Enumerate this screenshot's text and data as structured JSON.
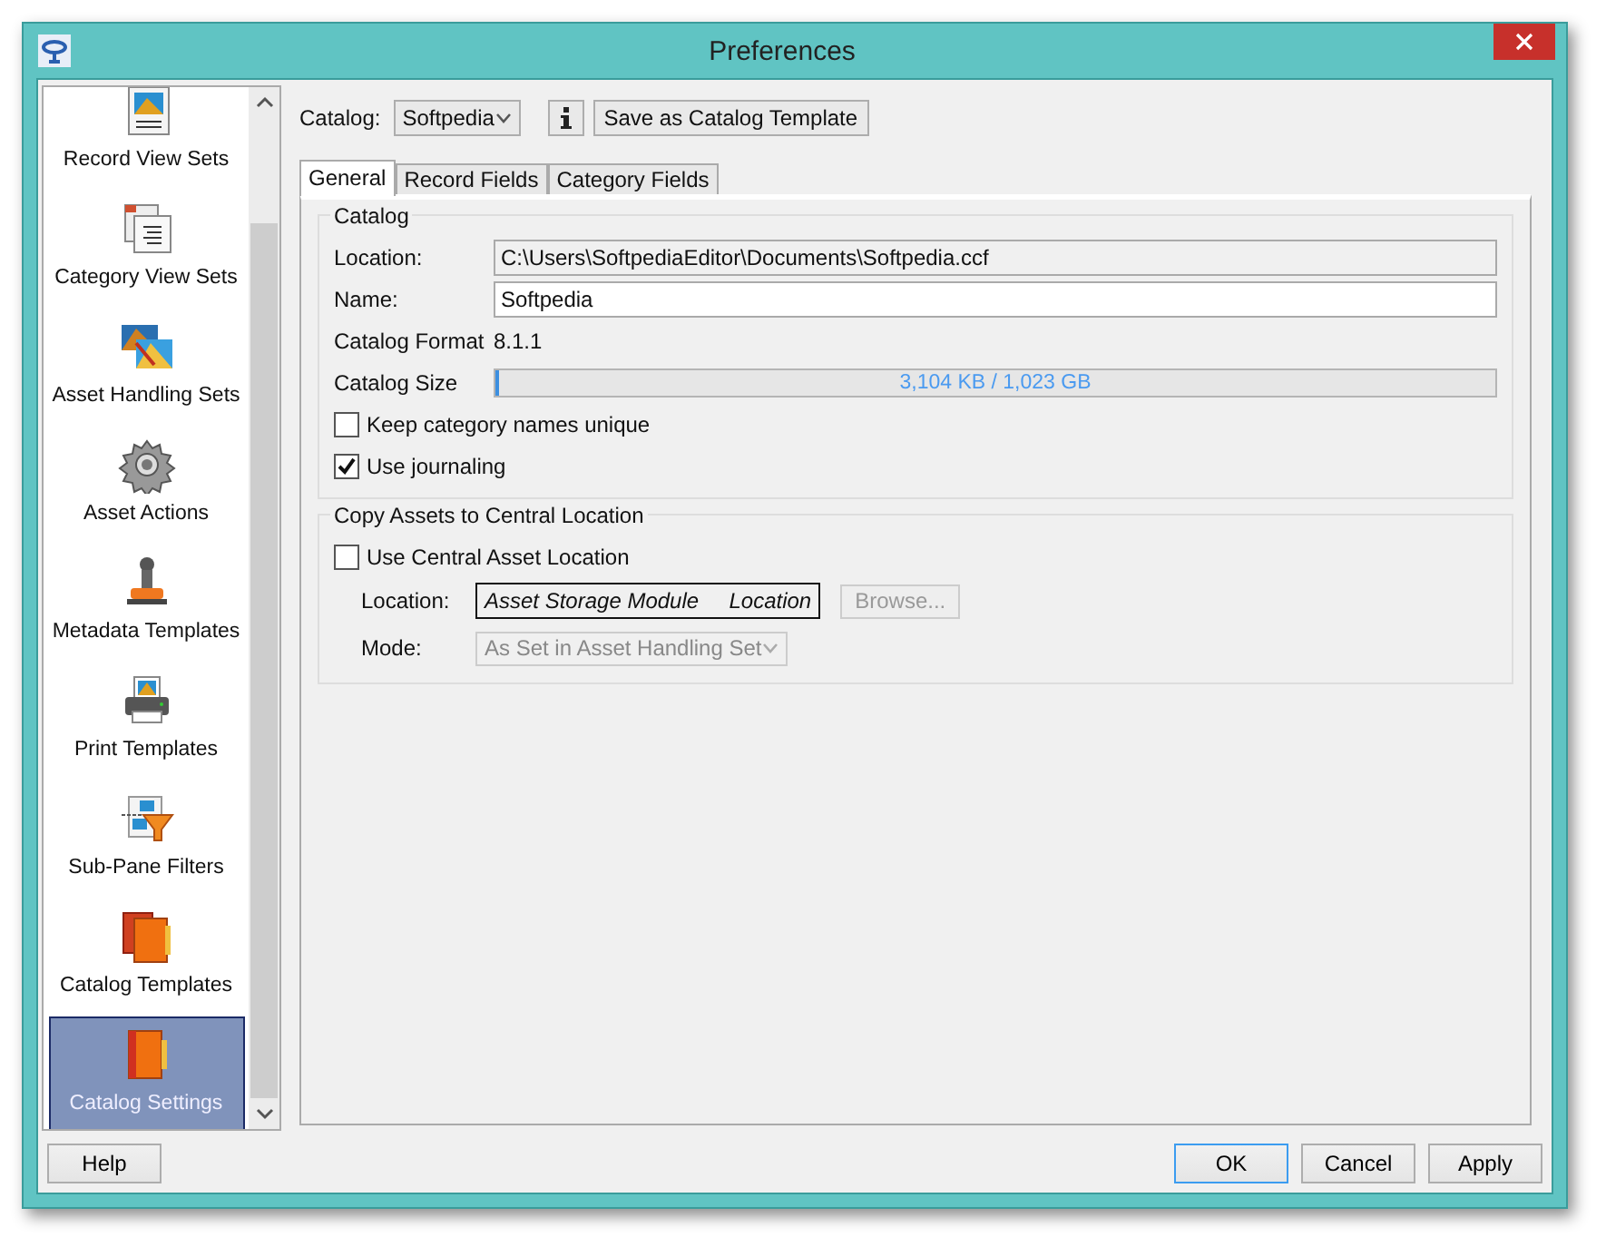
{
  "window": {
    "title": "Preferences"
  },
  "sidebar": {
    "items": [
      {
        "label": "Record View Sets",
        "selected": false
      },
      {
        "label": "Category View Sets",
        "selected": false
      },
      {
        "label": "Asset Handling Sets",
        "selected": false
      },
      {
        "label": "Asset Actions",
        "selected": false
      },
      {
        "label": "Metadata Templates",
        "selected": false
      },
      {
        "label": "Print Templates",
        "selected": false
      },
      {
        "label": "Sub-Pane Filters",
        "selected": false
      },
      {
        "label": "Catalog Templates",
        "selected": false
      },
      {
        "label": "Catalog Settings",
        "selected": true
      }
    ]
  },
  "catalog_selector": {
    "label": "Catalog:",
    "value": "Softpedia"
  },
  "save_template_button": "Save as Catalog Template",
  "tabs": [
    {
      "label": "General",
      "selected": true
    },
    {
      "label": "Record Fields",
      "selected": false
    },
    {
      "label": "Category Fields",
      "selected": false
    }
  ],
  "catalog_group": {
    "title": "Catalog",
    "location_label": "Location:",
    "location": "C:\\Users\\SoftpediaEditor\\Documents\\Softpedia.ccf",
    "name_label": "Name:",
    "name": "Softpedia",
    "format_label": "Catalog Format",
    "format": "8.1.1",
    "size_label": "Catalog Size",
    "size": {
      "level": 0.003,
      "reading": "3,104 KB / 1,023 GB"
    },
    "checkboxes": [
      {
        "label": "Keep category names unique",
        "checked": false
      },
      {
        "label": "Use journaling",
        "checked": true
      }
    ]
  },
  "copy_group": {
    "title": "Copy Assets to Central Location",
    "checkbox": {
      "label": "Use Central Asset Location",
      "checked": false
    },
    "location_label": "Location:",
    "location": "Asset Storage Module     Location",
    "browse": {
      "label": "Browse...",
      "disabled": true
    },
    "mode_label": "Mode:",
    "mode": {
      "value": "As Set in Asset Handling Set",
      "disabled": true
    }
  },
  "buttons": [
    {
      "label": "Help",
      "default": false
    },
    {
      "label": "OK",
      "default": true
    },
    {
      "label": "Cancel",
      "default": false
    },
    {
      "label": "Apply",
      "default": false
    }
  ]
}
